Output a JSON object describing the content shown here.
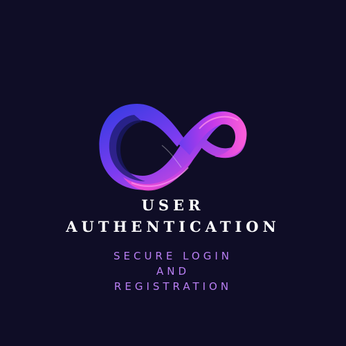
{
  "title": {
    "line1": "USER",
    "line2": "AUTHENTICATION"
  },
  "subtitle": {
    "line1": "SECURE LOGIN",
    "line2": "AND",
    "line3": "REGISTRATION"
  },
  "logo": {
    "icon": "infinity-icon",
    "colors": [
      "#3f3fe6",
      "#7b3cf0",
      "#c43ae8",
      "#ff4fd1"
    ]
  },
  "colors": {
    "background": "#0f0d26",
    "title": "#ffffff",
    "subtitle": "#b97ff3"
  }
}
